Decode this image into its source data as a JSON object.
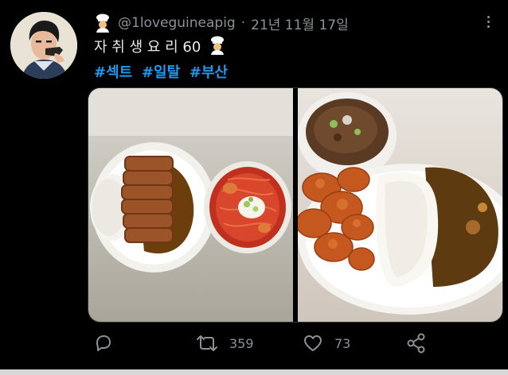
{
  "tweet": {
    "handle": "@1loveguineapig",
    "separator": "·",
    "date": "21년 11월 17일",
    "text": "자 취 생 요 리 60",
    "hashtags": [
      "#섹트",
      "#일탈",
      "#부산"
    ],
    "icons": [
      "avatar",
      "chef-emoji",
      "more-icon",
      "reply-icon",
      "retweet-icon",
      "like-icon",
      "share-icon"
    ],
    "actions": {
      "reply_count": "",
      "retweet_count": "359",
      "like_count": "73"
    }
  },
  "colors": {
    "background": "#000000",
    "text": "#e7e9ea",
    "muted": "#8b9196",
    "link": "#1d9bf0"
  }
}
